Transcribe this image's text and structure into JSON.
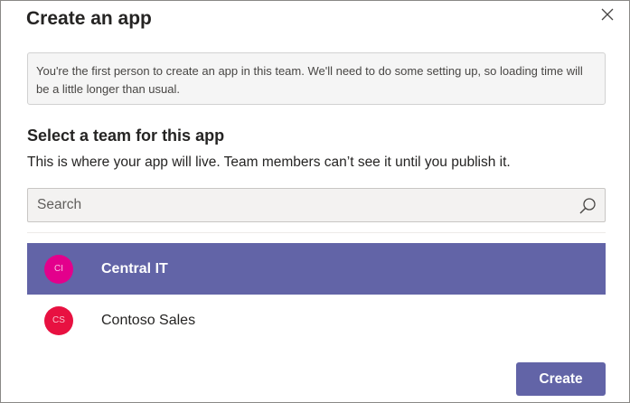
{
  "dialog": {
    "title": "Create an app",
    "close_icon": "close-icon"
  },
  "notice": {
    "text": "You're the first person to create an app in this team. We'll need to do some setting up, so loading time will be a little longer than usual."
  },
  "team_section": {
    "title": "Select a team for this app",
    "description": "This is where your app will live. Team members can’t see it until you publish it."
  },
  "search": {
    "placeholder": "Search",
    "value": "",
    "icon": "search-icon"
  },
  "teams": [
    {
      "initials": "CI",
      "name": "Central IT",
      "avatar_color": "#e3008c",
      "selected": true
    },
    {
      "initials": "CS",
      "name": "Contoso Sales",
      "avatar_color": "#e81141",
      "selected": false
    }
  ],
  "actions": {
    "create_label": "Create"
  },
  "colors": {
    "accent": "#6264a7",
    "notice_bg": "#f5f5f5",
    "search_bg": "#f3f2f1"
  }
}
